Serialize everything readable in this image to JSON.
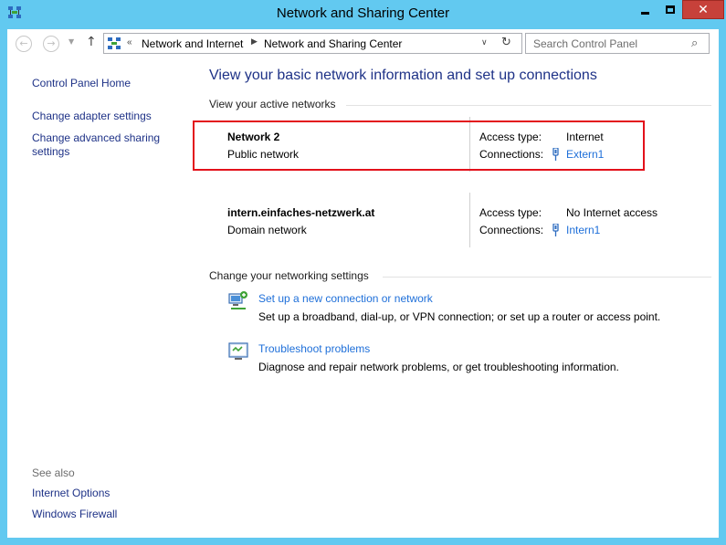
{
  "window": {
    "title": "Network and Sharing Center",
    "close_glyph": "✕"
  },
  "toolbar": {
    "back_glyph": "←",
    "forward_glyph": "→",
    "up_glyph": "↑",
    "address_sep": "«",
    "breadcrumbs": [
      "Network and Internet",
      "Network and Sharing Center"
    ],
    "crumb_arrow": "▶",
    "dropdown_glyph": "∨",
    "refresh_glyph": "↻",
    "search_placeholder": "Search Control Panel",
    "search_glyph": "⌕"
  },
  "sidebar": {
    "links": [
      "Control Panel Home",
      "Change adapter settings",
      "Change advanced sharing settings"
    ],
    "see_also_label": "See also",
    "see_also_links": [
      "Internet Options",
      "Windows Firewall"
    ]
  },
  "main": {
    "heading": "View your basic network information and set up connections",
    "active_networks_label": "View your active networks",
    "networks": [
      {
        "name": "Network  2",
        "type": "Public network",
        "access_label": "Access type:",
        "access_value": "Internet",
        "connections_label": "Connections:",
        "connection": "Extern1"
      },
      {
        "name": "intern.einfaches-netzwerk.at",
        "type": "Domain network",
        "access_label": "Access type:",
        "access_value": "No Internet access",
        "connections_label": "Connections:",
        "connection": "Intern1"
      }
    ],
    "settings_label": "Change your networking settings",
    "tasks": [
      {
        "icon": "new-connection-icon",
        "link": "Set up a new connection or network",
        "desc": "Set up a broadband, dial-up, or VPN connection; or set up a router or access point."
      },
      {
        "icon": "troubleshoot-icon",
        "link": "Troubleshoot problems",
        "desc": "Diagnose and repair network problems, or get troubleshooting information."
      }
    ]
  },
  "colors": {
    "accent_link": "#1e6fd9",
    "heading": "#1e3287",
    "highlight_border": "#e3111b",
    "window_frame": "#62c9f0",
    "close_button": "#c7413a"
  }
}
